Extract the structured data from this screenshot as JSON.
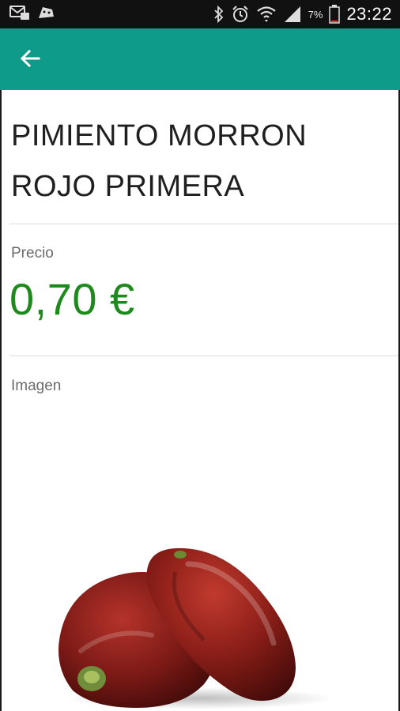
{
  "status_bar": {
    "battery_percent": "7%",
    "time": "23:22",
    "icons": [
      "mail-icon",
      "android-icon",
      "bluetooth-icon",
      "alarm-icon",
      "wifi-icon",
      "signal-icon",
      "battery-icon"
    ]
  },
  "app_bar": {
    "back_icon": "arrow-left-icon",
    "color": "#0f9b8a"
  },
  "product": {
    "name": "PIMIENTO MORRON ROJO PRIMERA",
    "price_label": "Precio",
    "price": "0,70 €",
    "price_color": "#1e8a1e",
    "image_label": "Imagen"
  }
}
